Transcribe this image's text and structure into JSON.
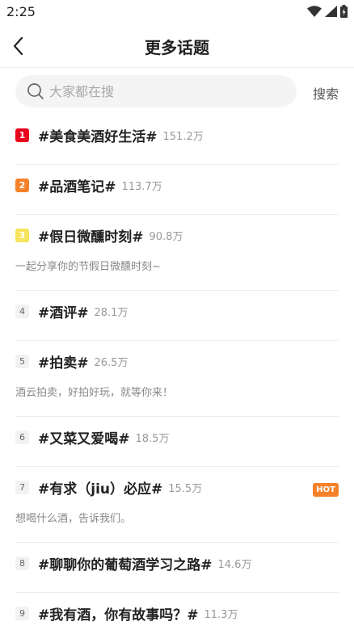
{
  "status_bar": {
    "time": "2:25",
    "icons": [
      "wifi-icon",
      "signal-icon",
      "battery-icon"
    ]
  },
  "app_bar": {
    "back_icon": "chevron-left-icon",
    "title": "更多话题"
  },
  "search": {
    "icon": "search-icon",
    "placeholder": "大家都在搜",
    "value": "",
    "button_label": "搜索"
  },
  "topics": [
    {
      "rank": "1",
      "title": "#美食美酒好生活#",
      "heat": "151.2万"
    },
    {
      "rank": "2",
      "title": "#品酒笔记#",
      "heat": "113.7万"
    },
    {
      "rank": "3",
      "title": "#假日微醺时刻#",
      "heat": "90.8万",
      "desc": "一起分享你的节假日微醺时刻~"
    },
    {
      "rank": "4",
      "title": "#酒评#",
      "heat": "28.1万"
    },
    {
      "rank": "5",
      "title": "#拍卖#",
      "heat": "26.5万",
      "desc": "酒云拍卖，好拍好玩，就等你来！"
    },
    {
      "rank": "6",
      "title": "#又菜又爱喝#",
      "heat": "18.5万"
    },
    {
      "rank": "7",
      "title": "#有求（jiu）必应#",
      "heat": "15.5万",
      "desc": "想喝什么酒，告诉我们。",
      "badge": "HOT"
    },
    {
      "rank": "8",
      "title": "#聊聊你的葡萄酒学习之路#",
      "heat": "14.6万"
    },
    {
      "rank": "9",
      "title": "#我有酒，你有故事吗？#",
      "heat": "11.3万"
    }
  ],
  "colors": {
    "rank1": "#e8001d",
    "rank2": "#f5822a",
    "rank3": "#f6e45b",
    "hot_badge": "#f5822a"
  }
}
